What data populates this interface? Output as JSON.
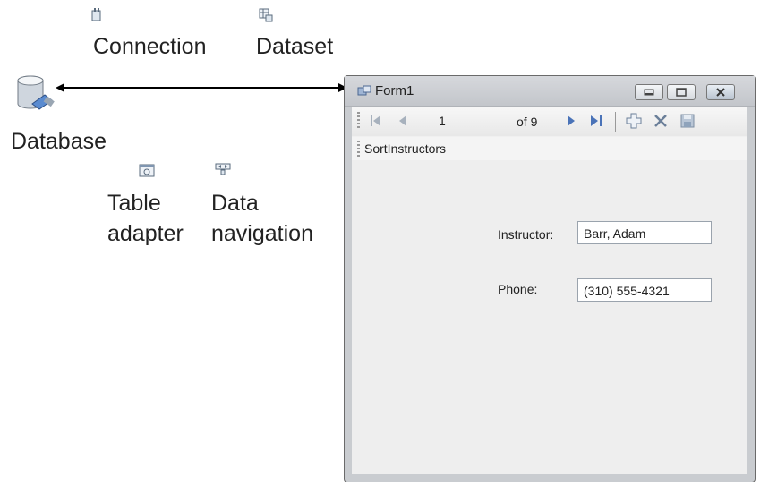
{
  "labels": {
    "connection": "Connection",
    "dataset": "Dataset",
    "database": "Database",
    "table_adapter_line1": "Table",
    "table_adapter_line2": "adapter",
    "data_navigation_line1": "Data",
    "data_navigation_line2": "navigation"
  },
  "icons": {
    "connection": "connection-icon",
    "dataset": "dataset-icon",
    "database": "database-icon",
    "table_adapter": "table-adapter-icon",
    "data_navigation": "data-navigation-icon"
  },
  "form": {
    "title": "Form1",
    "navigator": {
      "position": "1",
      "count_label": "of 9"
    },
    "menu_item": "SortInstructors",
    "fields": [
      {
        "label": "Instructor:",
        "value": "Barr, Adam"
      },
      {
        "label": "Phone:",
        "value": "(310) 555-4321"
      }
    ]
  },
  "colors": {
    "arrow": "#000000",
    "window_frame": "#c9ccd0",
    "toolbar_icons": "#4a73b8"
  }
}
